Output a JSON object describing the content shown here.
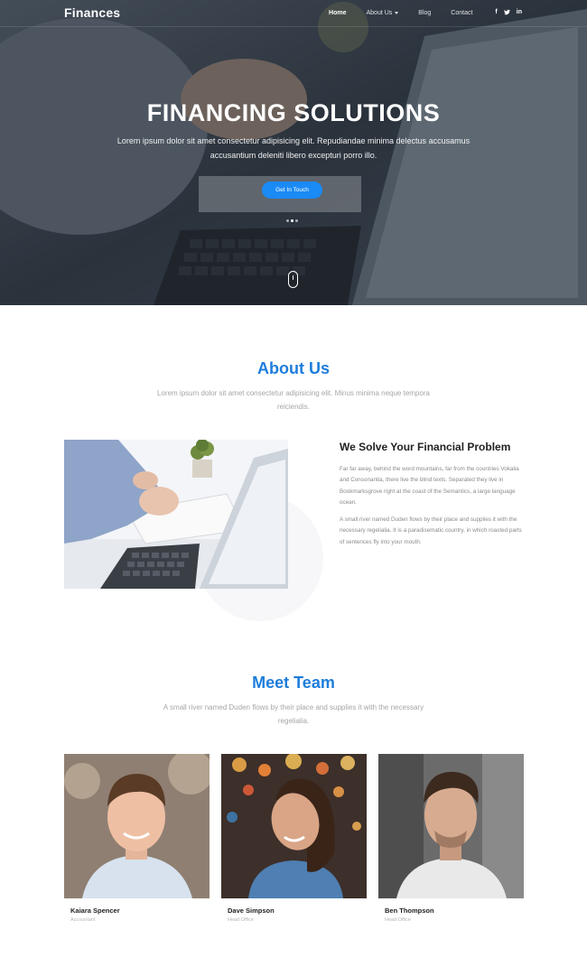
{
  "nav": {
    "brand": "Finances",
    "links": [
      "Home",
      "About Us",
      "Blog",
      "Contact"
    ],
    "social": [
      "f",
      "t",
      "in"
    ]
  },
  "hero": {
    "title": "FINANCING SOLUTIONS",
    "subtitle": "Lorem ipsum dolor sit amet consectetur adipisicing elit. Repudiandae minima delectus accusamus accusantium deleniti libero excepturi porro illo.",
    "button": "Get In Touch"
  },
  "about": {
    "title": "About Us",
    "description": "Lorem ipsum dolor sit amet consectetur adipisicing elit. Minus minima neque tempora reiciendis.",
    "heading": "We Solve Your Financial Problem",
    "paragraph1": "Far far away, behind the word mountains, far from the countries Vokalia and Consonantia, there live the blind texts. Separated they live in Bookmarksgrove right at the coast of the Semantics, a large language ocean.",
    "paragraph2": "A small river named Duden flows by their place and supplies it with the necessary regelialia. It is a paradisematic country, in which roasted parts of sentences fly into your mouth."
  },
  "team": {
    "title": "Meet Team",
    "description": "A small river named Duden flows by their place and supplies it with the necessary regelialia.",
    "members": [
      {
        "name": "Kaiara Spencer",
        "role": "Accountant"
      },
      {
        "name": "Dave Simpson",
        "role": "Head Office"
      },
      {
        "name": "Ben Thompson",
        "role": "Head Office"
      }
    ]
  },
  "colors": {
    "accent": "#1e7ddb",
    "button": "#1a8af5"
  }
}
